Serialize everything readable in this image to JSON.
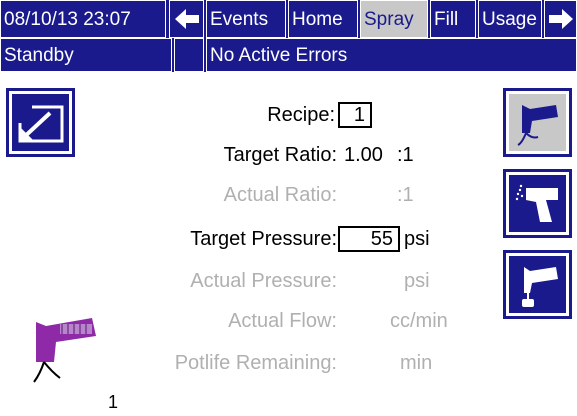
{
  "header": {
    "datetime": "08/10/13 23:07",
    "tabs": [
      {
        "label": "Events",
        "active": false
      },
      {
        "label": "Home",
        "active": false
      },
      {
        "label": "Spray",
        "active": true
      },
      {
        "label": "Fill",
        "active": false
      },
      {
        "label": "Usage",
        "active": false
      }
    ],
    "left_arrow_icon": "arrow-left-icon",
    "right_arrow_icon": "arrow-right-icon"
  },
  "status": {
    "mode": "Standby",
    "errors": "No Active Errors"
  },
  "form": {
    "recipe_label": "Recipe:",
    "recipe_value": "1",
    "target_ratio_label": "Target Ratio:",
    "target_ratio_value": "1.00",
    "target_ratio_unit": ":1",
    "actual_ratio_label": "Actual Ratio:",
    "actual_ratio_unit": ":1",
    "target_pressure_label": "Target Pressure:",
    "target_pressure_value": "55",
    "target_pressure_unit": "psi",
    "actual_pressure_label": "Actual Pressure:",
    "actual_pressure_unit": "psi",
    "actual_flow_label": "Actual Flow:",
    "actual_flow_unit": "cc/min",
    "potlife_label": "Potlife Remaining:",
    "potlife_unit": "min"
  },
  "gun_number": "1",
  "colors": {
    "brand_blue": "#1a1a8c",
    "active_gray": "#c8c8c8",
    "gun_purple": "#8e2aa8",
    "dim_text": "#b0b0b0"
  },
  "icons": {
    "edit": "edit-icon",
    "spray_gun": "spray-gun-icon",
    "spray_gun_side": "spray-gun-side-icon",
    "spray_gun_flush": "spray-gun-flush-icon",
    "status_gun": "gun-status-icon"
  }
}
